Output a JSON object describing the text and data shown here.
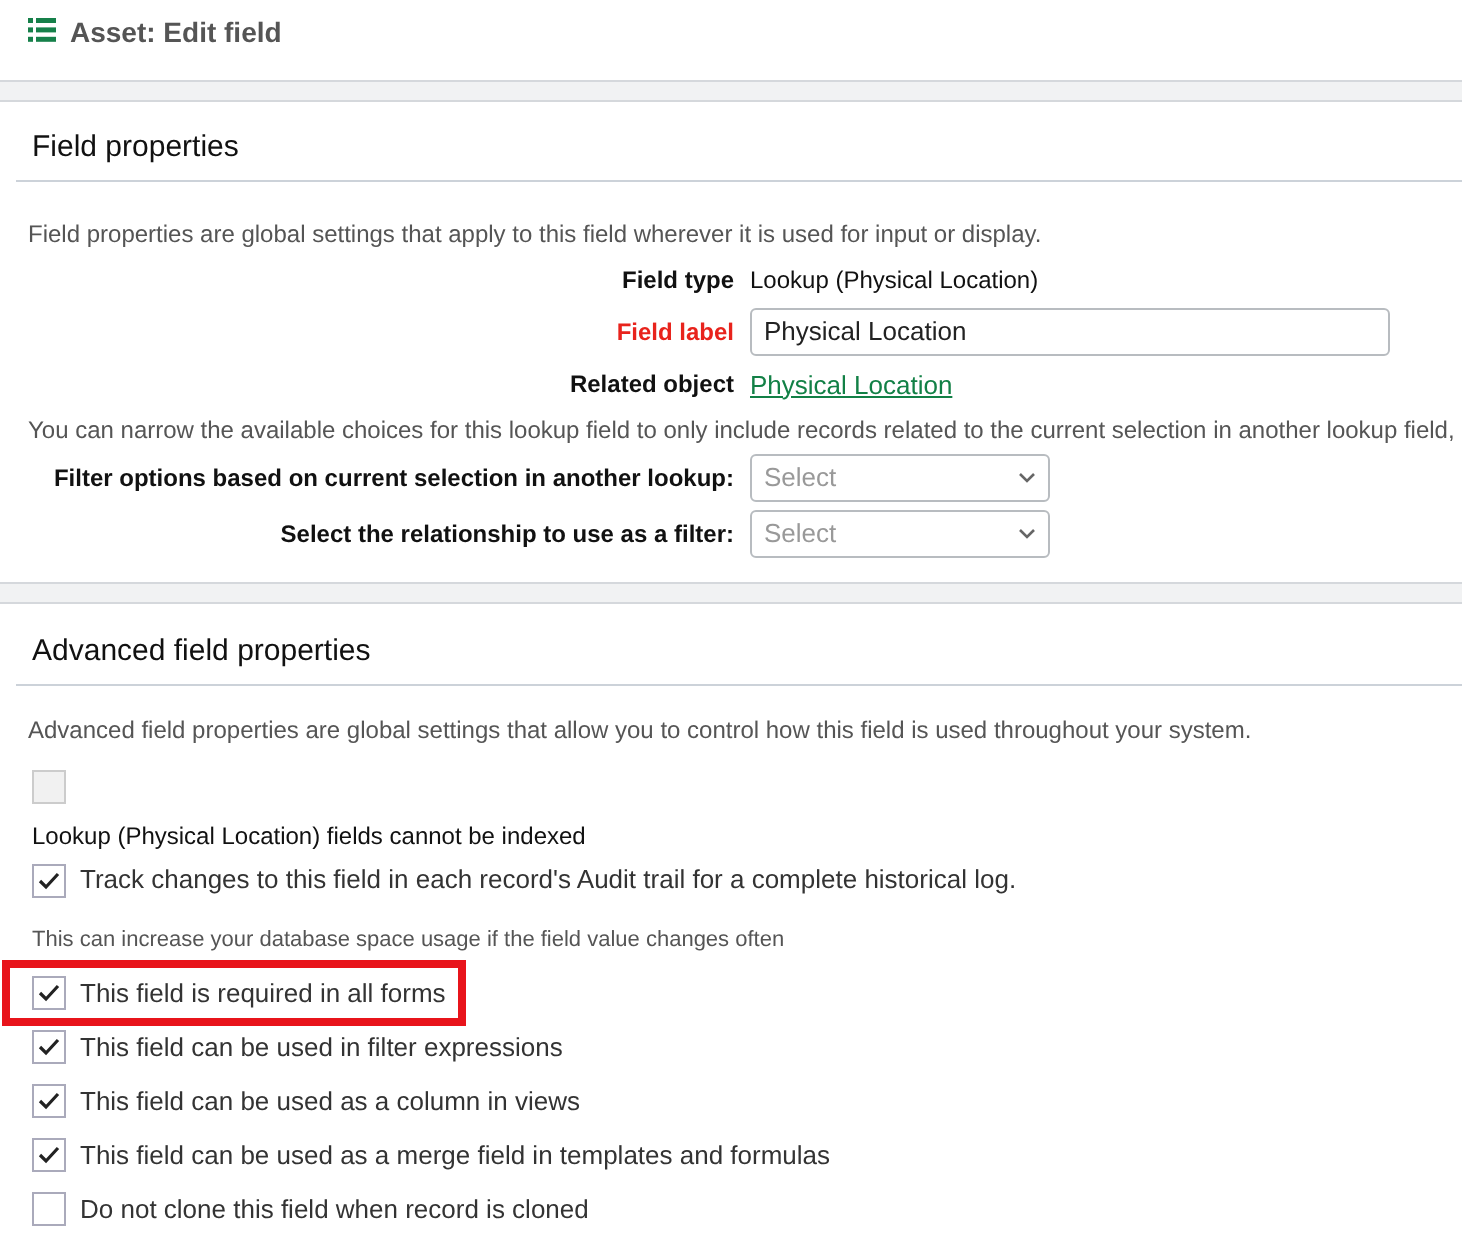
{
  "page_title": "Asset: Edit field",
  "field_properties": {
    "heading": "Field properties",
    "description": "Field properties are global settings that apply to this field wherever it is used for input or display.",
    "rows": [
      {
        "kind": "text",
        "label": "Field type",
        "required": false,
        "value": "Lookup (Physical Location)"
      },
      {
        "kind": "input",
        "label": "Field label",
        "required": true,
        "value": "Physical Location"
      },
      {
        "kind": "link",
        "label": "Related object",
        "required": false,
        "value": "Physical Location"
      }
    ],
    "filter_note": "You can narrow the available choices for this lookup field to only include records related to the current selection in another lookup field,",
    "filters": [
      {
        "label": "Filter options based on current selection in another lookup:",
        "placeholder": "Select"
      },
      {
        "label": "Select the relationship to use as a filter:",
        "placeholder": "Select"
      }
    ]
  },
  "advanced_properties": {
    "heading": "Advanced field properties",
    "description": "Advanced field properties are global settings that allow you to control how this field is used throughout your system.",
    "items": [
      {
        "kind": "checkbox",
        "checked": false,
        "disabled": true,
        "highlighted": false
      },
      {
        "kind": "note",
        "label": "Lookup (Physical Location) fields cannot be indexed"
      },
      {
        "kind": "checkbox",
        "label": "Track changes to this field in each record's Audit trail for a complete historical log.",
        "checked": true,
        "disabled": false,
        "highlighted": false
      },
      {
        "kind": "hint",
        "label": "This can increase your database space usage if the field value changes often"
      },
      {
        "kind": "checkbox",
        "label": "This field is required in all forms",
        "checked": true,
        "disabled": false,
        "highlighted": true
      },
      {
        "kind": "checkbox",
        "label": "This field can be used in filter expressions",
        "checked": true,
        "disabled": false,
        "highlighted": false
      },
      {
        "kind": "checkbox",
        "label": "This field can be used as a column in views",
        "checked": true,
        "disabled": false,
        "highlighted": false
      },
      {
        "kind": "checkbox",
        "label": "This field can be used as a merge field in templates and formulas",
        "checked": true,
        "disabled": false,
        "highlighted": false
      },
      {
        "kind": "checkbox",
        "label": "Do not clone this field when record is cloned",
        "checked": false,
        "disabled": false,
        "highlighted": false
      }
    ]
  }
}
